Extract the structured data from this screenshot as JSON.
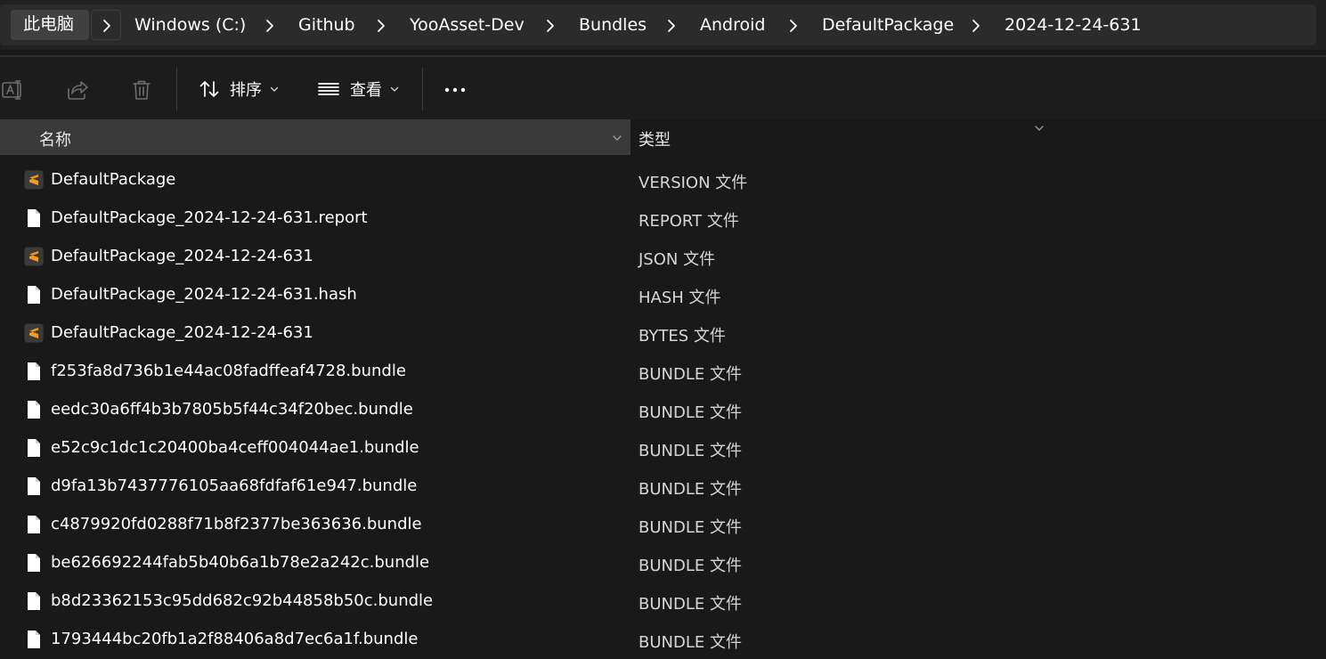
{
  "breadcrumb": {
    "items": [
      {
        "label": "此电脑"
      },
      {
        "label": "Windows (C:)"
      },
      {
        "label": "Github"
      },
      {
        "label": "YooAsset-Dev"
      },
      {
        "label": "Bundles"
      },
      {
        "label": "Android"
      },
      {
        "label": "DefaultPackage"
      },
      {
        "label": "2024-12-24-631"
      }
    ]
  },
  "toolbar": {
    "sort_label": "排序",
    "view_label": "查看",
    "icons": [
      "rename-icon",
      "share-icon",
      "delete-icon",
      "sort-icon",
      "view-icon",
      "more-icon"
    ]
  },
  "columns": {
    "name": "名称",
    "type": "类型"
  },
  "colors": {
    "accent_sublime": "#f59a1b",
    "background": "#191919",
    "header_selected": "#3a3a3a"
  },
  "files": [
    {
      "name": "DefaultPackage",
      "type": "VERSION 文件",
      "icon": "sublime-file-icon"
    },
    {
      "name": "DefaultPackage_2024-12-24-631.report",
      "type": "REPORT 文件",
      "icon": "blank-file-icon"
    },
    {
      "name": "DefaultPackage_2024-12-24-631",
      "type": "JSON 文件",
      "icon": "sublime-file-icon"
    },
    {
      "name": "DefaultPackage_2024-12-24-631.hash",
      "type": "HASH 文件",
      "icon": "blank-file-icon"
    },
    {
      "name": "DefaultPackage_2024-12-24-631",
      "type": "BYTES 文件",
      "icon": "sublime-file-icon"
    },
    {
      "name": "f253fa8d736b1e44ac08fadffeaf4728.bundle",
      "type": "BUNDLE 文件",
      "icon": "blank-file-icon"
    },
    {
      "name": "eedc30a6ff4b3b7805b5f44c34f20bec.bundle",
      "type": "BUNDLE 文件",
      "icon": "blank-file-icon"
    },
    {
      "name": "e52c9c1dc1c20400ba4ceff004044ae1.bundle",
      "type": "BUNDLE 文件",
      "icon": "blank-file-icon"
    },
    {
      "name": "d9fa13b7437776105aa68fdfaf61e947.bundle",
      "type": "BUNDLE 文件",
      "icon": "blank-file-icon"
    },
    {
      "name": "c4879920fd0288f71b8f2377be363636.bundle",
      "type": "BUNDLE 文件",
      "icon": "blank-file-icon"
    },
    {
      "name": "be626692244fab5b40b6a1b78e2a242c.bundle",
      "type": "BUNDLE 文件",
      "icon": "blank-file-icon"
    },
    {
      "name": "b8d23362153c95dd682c92b44858b50c.bundle",
      "type": "BUNDLE 文件",
      "icon": "blank-file-icon"
    },
    {
      "name": "1793444bc20fb1a2f88406a8d7ec6a1f.bundle",
      "type": "BUNDLE 文件",
      "icon": "blank-file-icon"
    }
  ]
}
